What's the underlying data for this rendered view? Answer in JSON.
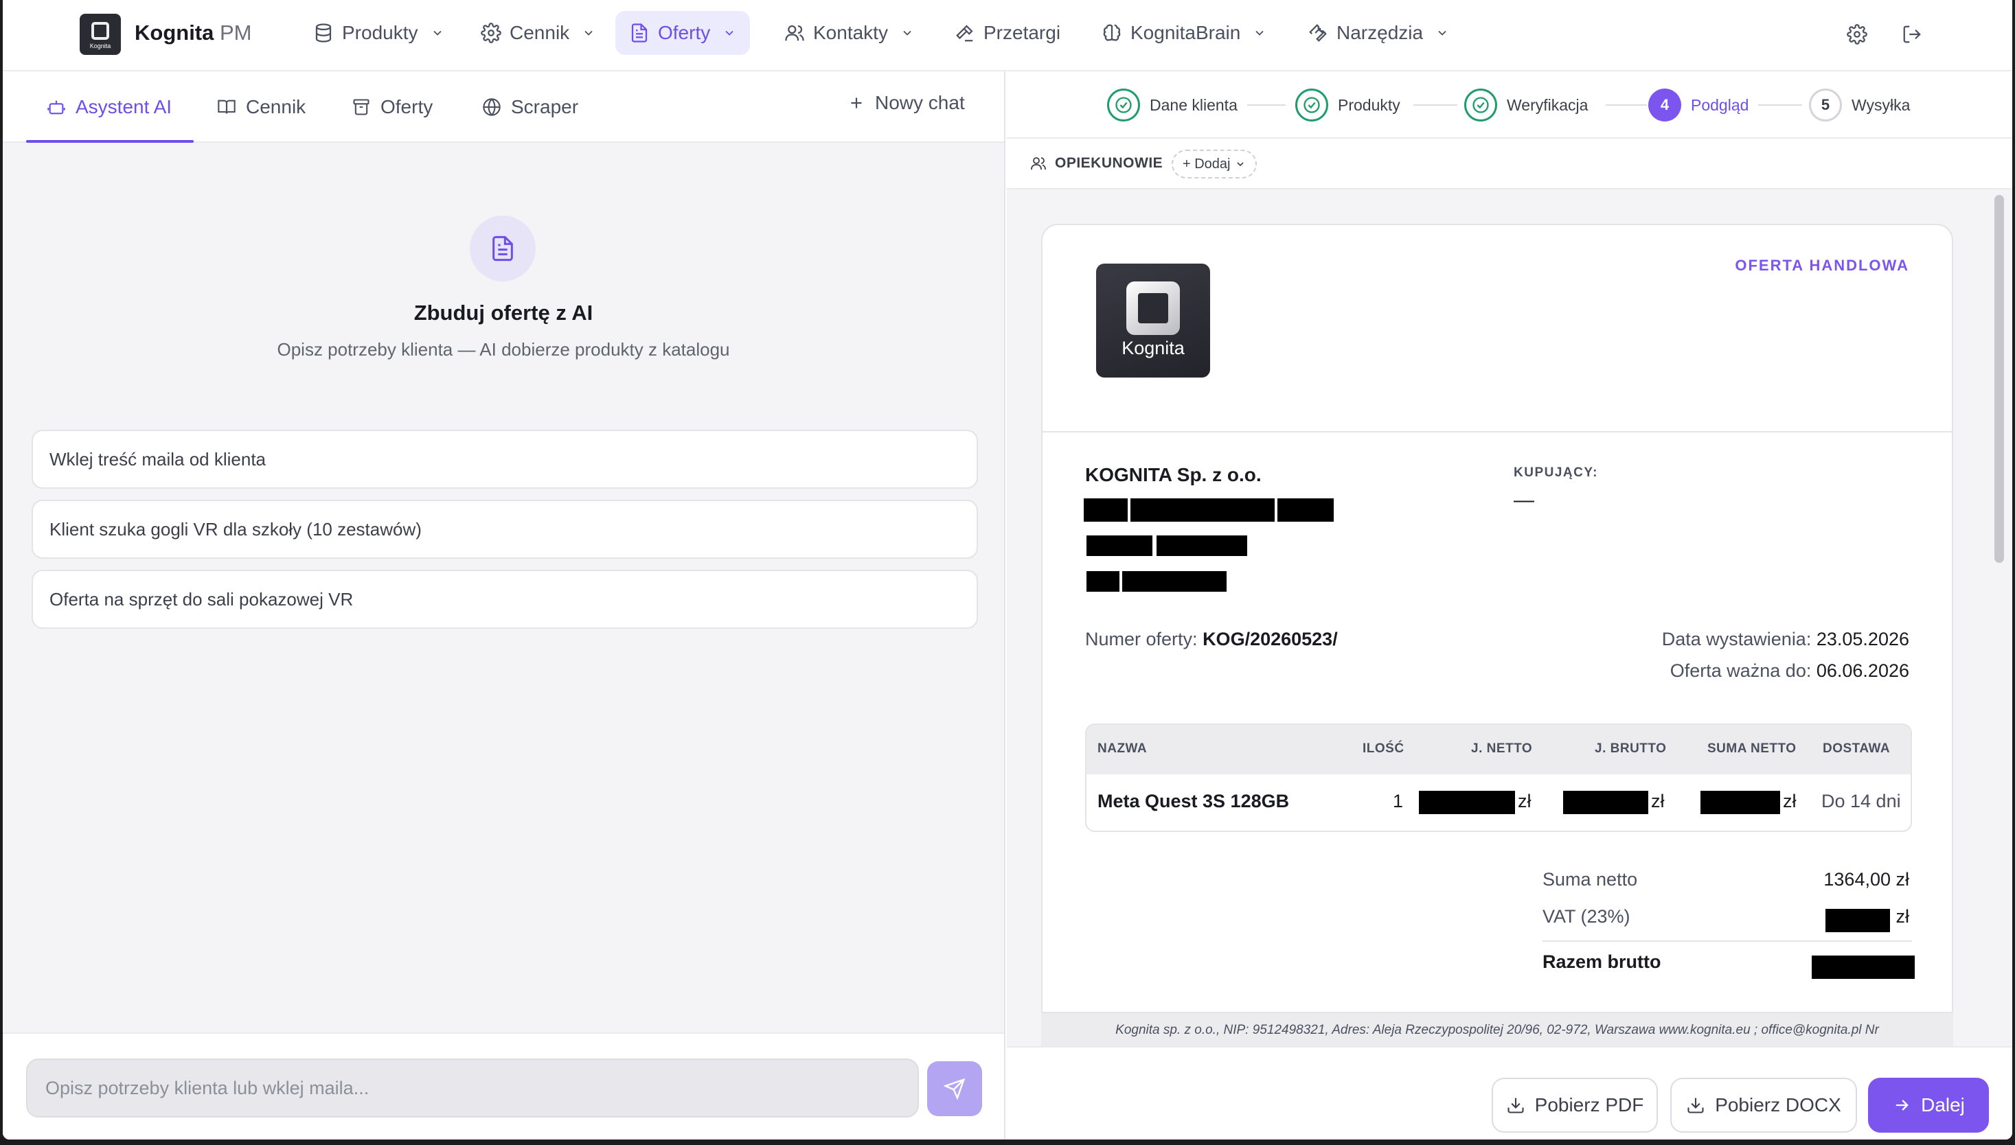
{
  "brand": {
    "name": "Kognita",
    "suffix": "PM",
    "logo_text": "Kognita"
  },
  "nav": {
    "items": [
      {
        "label": "Produkty",
        "icon": "database-icon"
      },
      {
        "label": "Cennik",
        "icon": "gear-icon"
      },
      {
        "label": "Oferty",
        "icon": "document-icon",
        "active": true
      },
      {
        "label": "Kontakty",
        "icon": "users-icon"
      },
      {
        "label": "Przetargi",
        "icon": "gavel-icon"
      },
      {
        "label": "KognitaBrain",
        "icon": "brain-icon"
      },
      {
        "label": "Narzędzia",
        "icon": "wrench-icon"
      }
    ]
  },
  "left": {
    "tabs": [
      {
        "label": "Asystent AI",
        "active": true
      },
      {
        "label": "Cennik"
      },
      {
        "label": "Oferty"
      },
      {
        "label": "Scraper"
      }
    ],
    "new_chat": "Nowy chat",
    "hero_title": "Zbuduj ofertę z AI",
    "hero_subtitle": "Opisz potrzeby klienta — AI dobierze produkty z katalogu",
    "suggestions": [
      "Wklej treść maila od klienta",
      "Klient szuka gogli VR dla szkoły (10 zestawów)",
      "Oferta na sprzęt do sali pokazowej VR"
    ],
    "composer_placeholder": "Opisz potrzeby klienta lub wklej maila..."
  },
  "stepper": {
    "steps": [
      {
        "num": "",
        "label": "Dane klienta",
        "state": "done"
      },
      {
        "num": "",
        "label": "Produkty",
        "state": "done"
      },
      {
        "num": "",
        "label": "Weryfikacja",
        "state": "done"
      },
      {
        "num": "4",
        "label": "Podgląd",
        "state": "current"
      },
      {
        "num": "5",
        "label": "Wysyłka",
        "state": "todo"
      }
    ]
  },
  "opiekunowie": {
    "label": "OPIEKUNOWIE",
    "add": "+ Dodaj"
  },
  "document": {
    "logo_text": "Kognita",
    "kind": "OFERTA HANDLOWA",
    "seller": "KOGNITA Sp. z o.o.",
    "buyer_label": "KUPUJĄCY:",
    "buyer_value": "—",
    "offer_number_label": "Numer oferty:",
    "offer_number": "KOG/20260523/",
    "issue_date_label": "Data wystawienia:",
    "issue_date": "23.05.2026",
    "valid_until_label": "Oferta ważna do:",
    "valid_until": "06.06.2026",
    "table": {
      "headers": [
        "NAZWA",
        "ILOŚĆ",
        "J. NETTO",
        "J. BRUTTO",
        "SUMA NETTO",
        "DOSTAWA"
      ],
      "rows": [
        {
          "name": "Meta Quest 3S 128GB",
          "qty": "1",
          "currency": "zł",
          "delivery": "Do 14 dni"
        }
      ]
    },
    "totals": {
      "net_label": "Suma netto",
      "net_value": "1364,00 zł",
      "vat_label": "VAT (23%)",
      "vat_currency": "zł",
      "gross_label": "Razem brutto"
    },
    "footer": "Kognita sp. z o.o., NIP: 9512498321, Adres: Aleja Rzeczypospolitej 20/96, 02-972, Warszawa www.kognita.eu ; office@kognita.pl Nr"
  },
  "actions": {
    "pdf": "Pobierz PDF",
    "docx": "Pobierz DOCX",
    "next": "Dalej"
  },
  "colors": {
    "accent": "#7b55ee",
    "success": "#1f9d6b"
  }
}
